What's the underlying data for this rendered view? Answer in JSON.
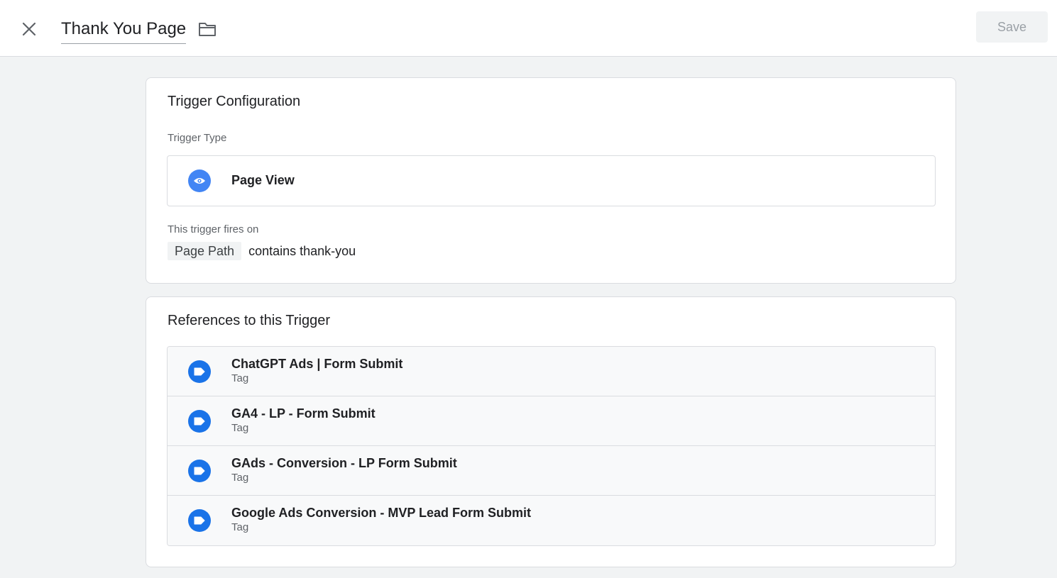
{
  "header": {
    "title": "Thank You Page",
    "save_label": "Save",
    "close_icon": "close-icon",
    "folder_icon": "folder-icon"
  },
  "trigger_config": {
    "title": "Trigger Configuration",
    "type_label": "Trigger Type",
    "type_name": "Page View",
    "type_icon": "eye-icon",
    "fires_on_label": "This trigger fires on",
    "condition": {
      "variable": "Page Path",
      "operator_value": "contains thank-you"
    }
  },
  "references": {
    "title": "References to this Trigger",
    "items": [
      {
        "name": "ChatGPT Ads | Form Submit",
        "type": "Tag"
      },
      {
        "name": "GA4 - LP - Form Submit",
        "type": "Tag"
      },
      {
        "name": "GAds - Conversion - LP Form Submit",
        "type": "Tag"
      },
      {
        "name": "Google Ads Conversion - MVP Lead Form Submit",
        "type": "Tag"
      }
    ]
  },
  "colors": {
    "accent": "#1a73e8",
    "eye_accent": "#4285f4",
    "background": "#f1f3f4"
  }
}
